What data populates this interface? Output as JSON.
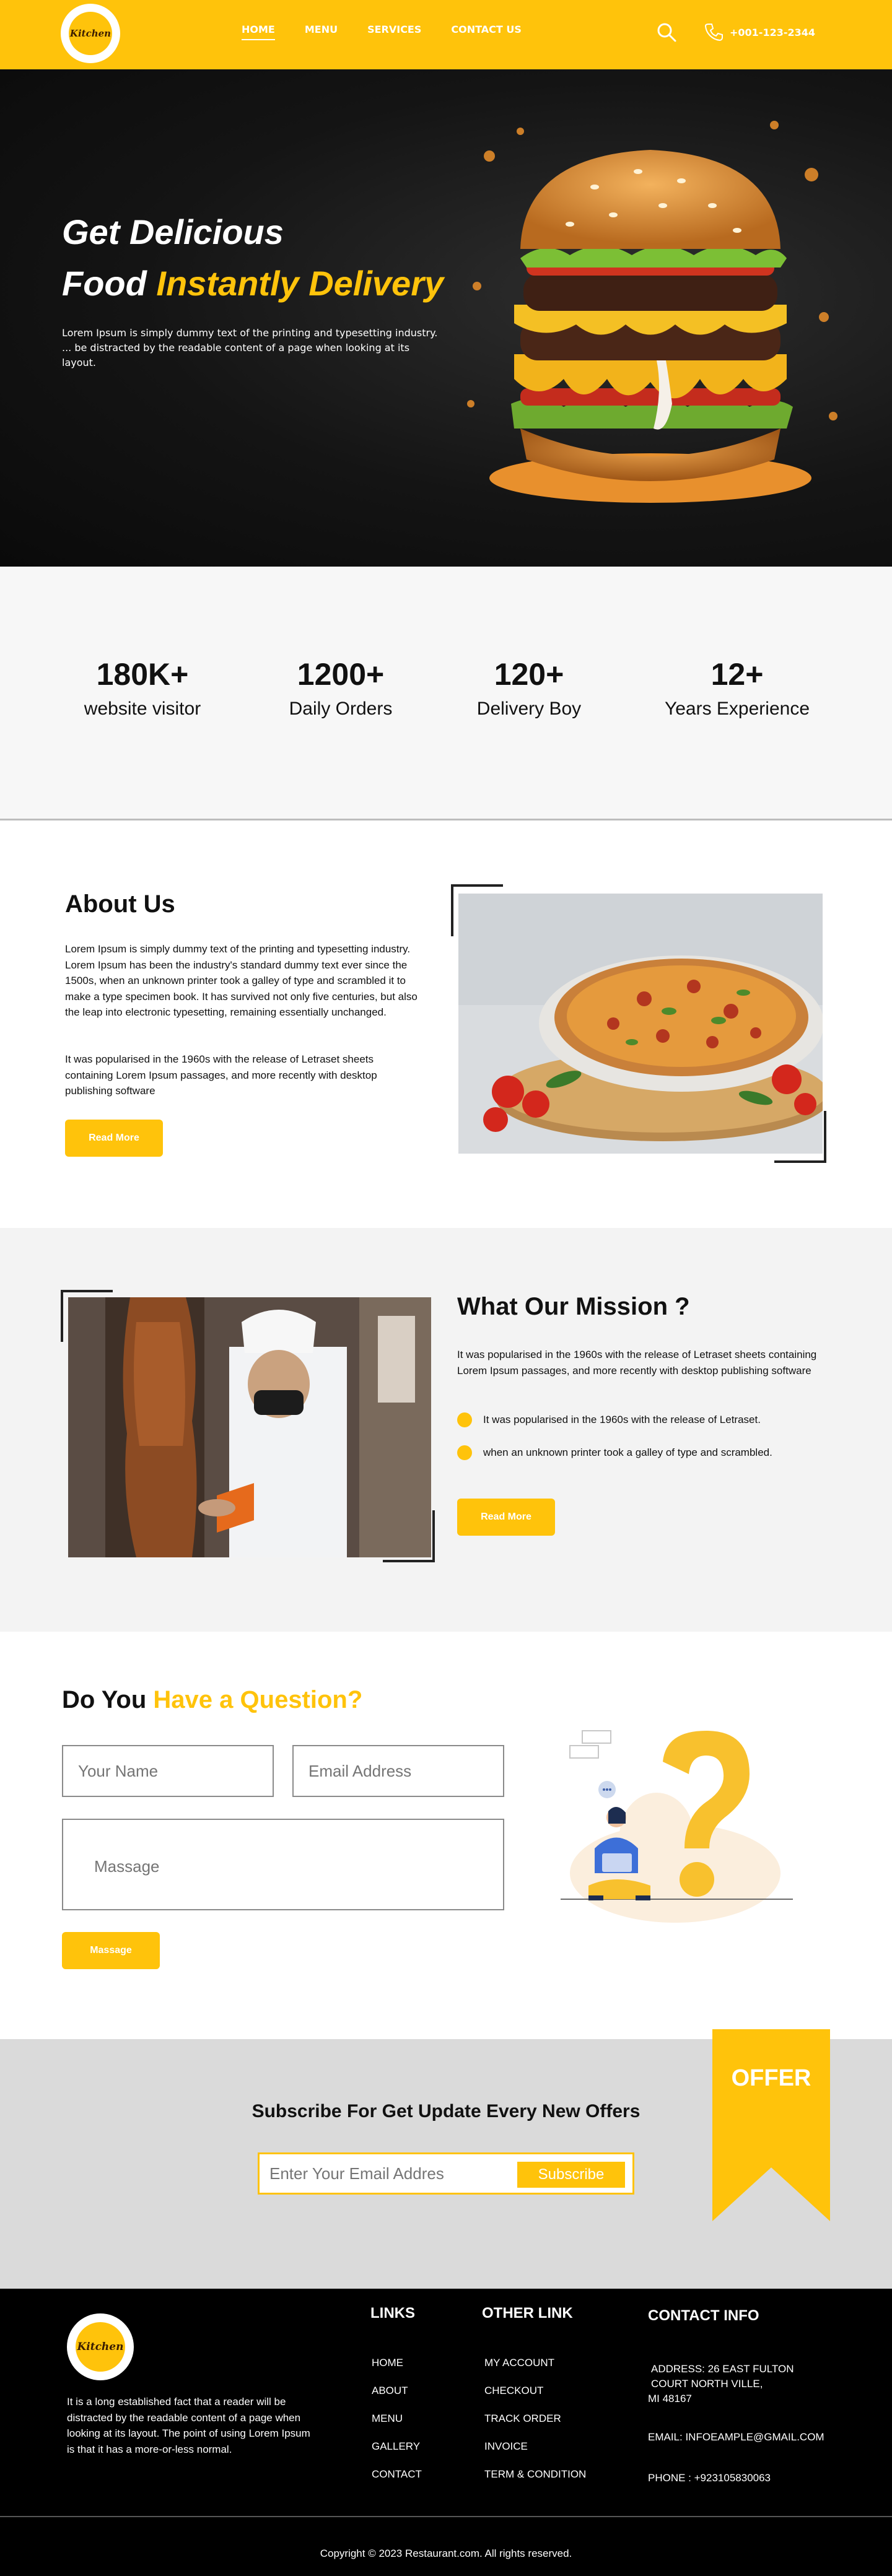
{
  "header": {
    "logo_text": "Kitchen",
    "nav": [
      "HOME",
      "MENU",
      "SERVICES",
      "CONTACT US"
    ],
    "phone": "+001-123-2344"
  },
  "hero": {
    "title_line1": "Get Delicious",
    "title_line2_white": "Food",
    "title_line2_yellow": "Instantly Delivery",
    "description": "Lorem Ipsum is simply dummy text of the printing and typesetting industry. ... be distracted by the readable content of a page when looking at its layout."
  },
  "stats": [
    {
      "value": "180K+",
      "label": "website visitor"
    },
    {
      "value": "1200+",
      "label": "Daily Orders"
    },
    {
      "value": "120+",
      "label": "Delivery Boy"
    },
    {
      "value": "12+",
      "label": "Years Experience"
    }
  ],
  "about": {
    "title": "About Us",
    "para1": "Lorem Ipsum is simply dummy text of the printing and typesetting industry. Lorem Ipsum has been the industry's standard dummy text ever since the 1500s, when an unknown printer took a galley of type and scrambled it to make a type specimen book. It has survived not only five centuries, but also the leap into electronic typesetting, remaining essentially unchanged.",
    "para2": "It was popularised in the 1960s with the release of Letraset sheets containing Lorem Ipsum passages, and more recently with desktop publishing software",
    "button": "Read More"
  },
  "mission": {
    "title": "What Our Mission ?",
    "para": "It was popularised in the 1960s with the release of Letraset sheets containing Lorem Ipsum passages, and more recently with desktop publishing software",
    "bullets": [
      "It was popularised in the 1960s with the release of Letraset.",
      "when an unknown printer took a galley of type and scrambled."
    ],
    "button": "Read More"
  },
  "question": {
    "title_black": "Do You",
    "title_yellow": "Have a Question?",
    "name_placeholder": "Your Name",
    "email_placeholder": "Email Address",
    "message_placeholder": "Massage",
    "button": "Massage"
  },
  "subscribe": {
    "title": "Subscribe For Get Update Every New Offers",
    "email_placeholder": "Enter Your Email Addres",
    "button": "Subscribe",
    "offer": "OFFER"
  },
  "footer": {
    "about_text": "It is a long established fact that a reader will be distracted by the readable content of a page when looking at its layout. The point of using Lorem Ipsum is that it has a more-or-less normal.",
    "links_title": "LINKS",
    "links": [
      "HOME",
      "ABOUT",
      "MENU",
      "GALLERY",
      "CONTACT"
    ],
    "other_title": "OTHER LINK",
    "other_links": [
      "MY ACCOUNT",
      "CHECKOUT",
      "TRACK ORDER",
      "INVOICE",
      "TERM & CONDITION"
    ],
    "contact_title": "CONTACT INFO",
    "address_line1": "ADDRESS: 26 EAST FULTON",
    "address_line2": "COURT NORTH VILLE,",
    "address_line3": "MI 48167",
    "email": "EMAIL: INFOEAMPLE@GMAIL.COM",
    "phone": "PHONE : +923105830063",
    "copyright": "Copyright © 2023 Restaurant.com. All rights reserved."
  },
  "colors": {
    "accent": "#ffc30b",
    "dark": "#000000"
  }
}
